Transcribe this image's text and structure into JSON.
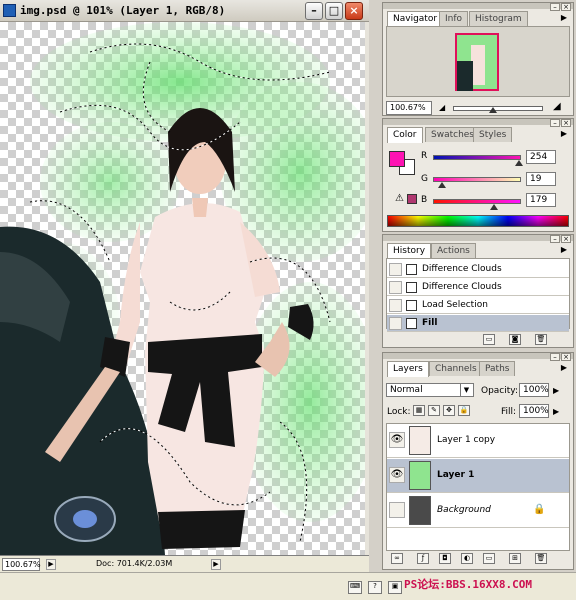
{
  "document": {
    "title": "img.psd @ 101% (Layer 1, RGB/8)",
    "zoom": "100.67%",
    "doc_info": "Doc: 701.4K/2.03M"
  },
  "navigator": {
    "tabs": [
      "Navigator",
      "Info",
      "Histogram"
    ],
    "zoom": "100.67%"
  },
  "color": {
    "tabs": [
      "Color",
      "Swatches",
      "Styles"
    ],
    "channels": [
      {
        "label": "R",
        "value": "254"
      },
      {
        "label": "G",
        "value": "19"
      },
      {
        "label": "B",
        "value": "179"
      }
    ],
    "foreground": "#fe13b3",
    "background": "#ffffff"
  },
  "history": {
    "tabs": [
      "History",
      "Actions"
    ],
    "items": [
      "Difference Clouds",
      "Difference Clouds",
      "Load Selection",
      "Fill"
    ]
  },
  "layers": {
    "tabs": [
      "Layers",
      "Channels",
      "Paths"
    ],
    "blend_mode": "Normal",
    "opacity_label": "Opacity:",
    "opacity": "100%",
    "lock_label": "Lock:",
    "fill_label": "Fill:",
    "fill": "100%",
    "items": [
      "Layer 1 copy",
      "Layer 1",
      "Background"
    ]
  },
  "watermark": "PS论坛:BBS.16XX8.COM",
  "icons": [
    "close-icon",
    "minimize-icon",
    "maximize-icon",
    "eye-icon",
    "lock-icon",
    "trash-icon",
    "new-layer-icon",
    "warning-icon",
    "chevron-down-icon"
  ]
}
